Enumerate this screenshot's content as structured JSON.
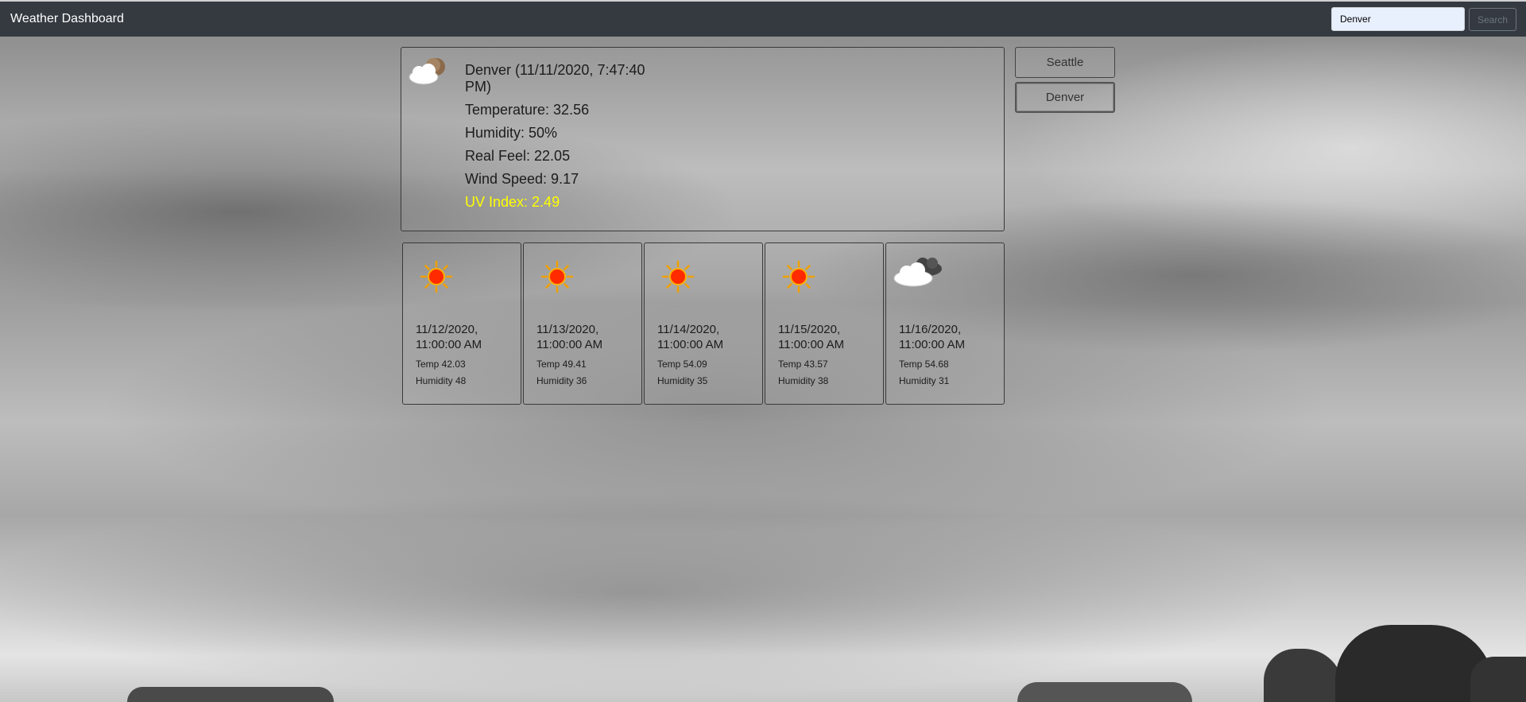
{
  "navbar": {
    "brand": "Weather Dashboard",
    "search_value": "Denver",
    "search_button": "Search"
  },
  "current": {
    "icon": "partly-cloudy-night-icon",
    "title": "Denver (11/11/2020, 7:47:40 PM)",
    "temperature": "Temperature: 32.56",
    "humidity": "Humidity: 50%",
    "real_feel": "Real Feel: 22.05",
    "wind_speed": "Wind Speed: 9.17",
    "uv_index": "UV Index: 2.49",
    "uv_color": "#ffff00"
  },
  "history": {
    "cities": [
      "Seattle",
      "Denver"
    ]
  },
  "forecast": [
    {
      "icon": "sun-icon",
      "date": "11/12/2020, 11:00:00 AM",
      "temp": "Temp 42.03",
      "humidity": "Humidity 48"
    },
    {
      "icon": "sun-icon",
      "date": "11/13/2020, 11:00:00 AM",
      "temp": "Temp 49.41",
      "humidity": "Humidity 36"
    },
    {
      "icon": "sun-icon",
      "date": "11/14/2020, 11:00:00 AM",
      "temp": "Temp 54.09",
      "humidity": "Humidity 35"
    },
    {
      "icon": "sun-icon",
      "date": "11/15/2020, 11:00:00 AM",
      "temp": "Temp 43.57",
      "humidity": "Humidity 38"
    },
    {
      "icon": "clouds-icon",
      "date": "11/16/2020, 11:00:00 AM",
      "temp": "Temp 54.68",
      "humidity": "Humidity 31"
    }
  ],
  "colors": {
    "navbar": "#343a40",
    "uv_warning": "#ffff00"
  }
}
